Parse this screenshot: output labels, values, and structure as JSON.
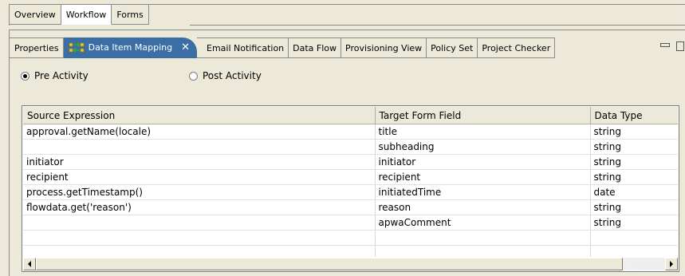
{
  "top_tabs": [
    {
      "label": "Overview",
      "active": false
    },
    {
      "label": "Workflow",
      "active": true
    },
    {
      "label": "Forms",
      "active": false
    }
  ],
  "view_tabs": [
    {
      "label": "Properties"
    },
    {
      "label": "Data Item Mapping",
      "active": true,
      "icon": "data-mapping-icon"
    },
    {
      "label": "Email Notification"
    },
    {
      "label": "Data Flow"
    },
    {
      "label": "Provisioning View"
    },
    {
      "label": "Policy Set"
    },
    {
      "label": "Project Checker"
    }
  ],
  "radios": {
    "pre_label": "Pre Activity",
    "post_label": "Post Activity",
    "selected": "Pre Activity"
  },
  "table": {
    "columns": [
      "Source Expression",
      "Target Form Field",
      "Data Type"
    ],
    "rows": [
      [
        "approval.getName(locale)",
        "title",
        "string"
      ],
      [
        "",
        "subheading",
        "string"
      ],
      [
        "initiator",
        "initiator",
        "string"
      ],
      [
        "recipient",
        "recipient",
        "string"
      ],
      [
        "process.getTimestamp()",
        "initiatedTime",
        "date"
      ],
      [
        "flowdata.get('reason')",
        "reason",
        "string"
      ],
      [
        "",
        "apwaComment",
        "string"
      ],
      [
        "",
        "",
        ""
      ],
      [
        "",
        "",
        ""
      ]
    ]
  },
  "colors": {
    "active_tab_bg": "#3a6ea5",
    "panel_bg": "#ece9d8"
  }
}
